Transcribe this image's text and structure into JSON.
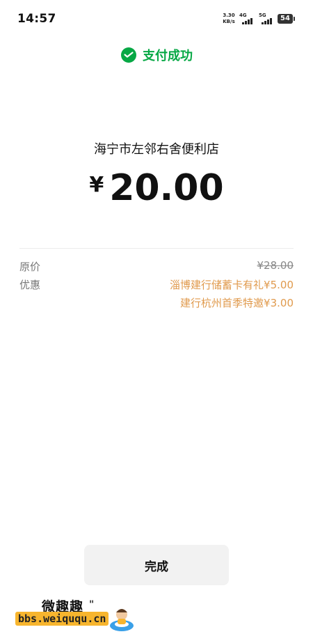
{
  "status_bar": {
    "time": "14:57",
    "net_speed_value": "3.30",
    "net_speed_unit": "KB/s",
    "signal_1": "4G",
    "signal_2": "5G",
    "battery": "54"
  },
  "header": {
    "status_text": "支付成功",
    "icon": "wechat-pay-icon"
  },
  "payment": {
    "merchant": "海宁市左邻右舍便利店",
    "currency": "¥",
    "amount": "20.00"
  },
  "details": {
    "original_label": "原价",
    "original_value": "¥28.00",
    "discount_label": "优惠",
    "discounts": [
      "淄博建行储蓄卡有礼¥5.00",
      "建行杭州首季特邀¥3.00"
    ]
  },
  "actions": {
    "done_label": "完成"
  },
  "watermark": {
    "title": "微趣趣",
    "site": "bbs.weiququ.cn",
    "mark": "\""
  },
  "colors": {
    "success_green": "#07a845",
    "discount_orange": "#e09a4d",
    "button_bg": "#f2f2f2"
  }
}
